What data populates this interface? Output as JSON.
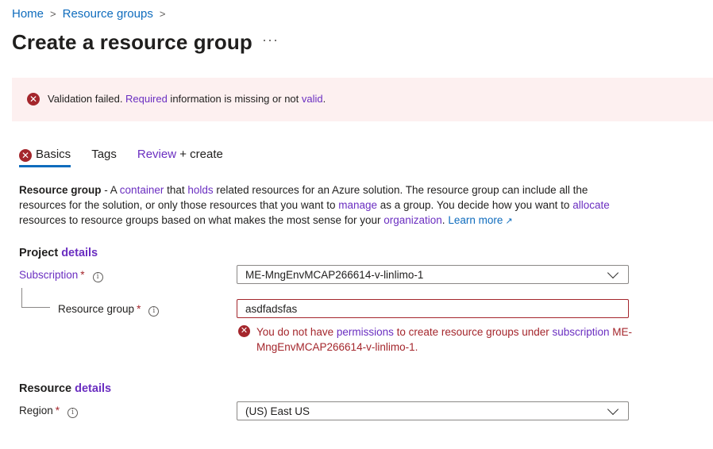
{
  "breadcrumb": {
    "home": "Home",
    "resource_groups": "Resource groups",
    "sep": ">"
  },
  "page": {
    "title": "Create a resource group",
    "more": "···"
  },
  "banner": {
    "part1": "Validation failed. ",
    "link1": "Required",
    "part2": " information is missing or not ",
    "link2": "valid",
    "part3": "."
  },
  "tabs": {
    "basics": "Basics",
    "tags": "Tags",
    "review_link": "Review",
    "review_rest": " + create"
  },
  "description": {
    "bold": "Resource group",
    "t1": " - A ",
    "l1": "container",
    "t2": " that ",
    "l2": "holds",
    "t3": " related resources for an Azure solution. The resource group can include all the resources for the solution, or only those resources that you want to ",
    "l3": "manage",
    "t4": " as a group. You decide how you want to ",
    "l4": "allocate",
    "t5": " resources to resource groups based on what makes the most sense for your ",
    "l5": "organization",
    "t6": ". ",
    "learn_more": "Learn more"
  },
  "project": {
    "title_plain": "Project ",
    "title_link": "details",
    "subscription_label": "Subscription",
    "required_mark": "*",
    "subscription_value": "ME-MngEnvMCAP266614-v-linlimo-1",
    "rg_label": "Resource group",
    "rg_value": "asdfadsfas",
    "error": {
      "t1": "You do not have ",
      "l1": "permissions",
      "t2": " to create resource groups under ",
      "l2": "subscription",
      "t3": " ME-MngEnvMCAP266614-v-linlimo-1."
    }
  },
  "resource": {
    "title_plain": "Resource ",
    "title_link": "details",
    "region_label": "Region",
    "region_value": "(US) East US"
  },
  "colors": {
    "accent": "#0f6cbd",
    "error": "#a4262c",
    "banner_bg": "#fdf0f0",
    "link_purple": "#6b2fc1"
  }
}
